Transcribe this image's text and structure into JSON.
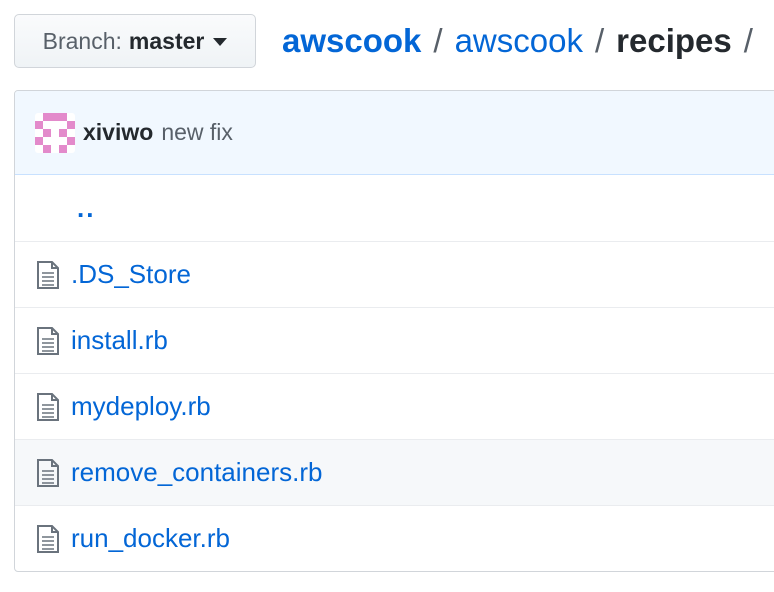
{
  "branch": {
    "prefix": "Branch:",
    "name": "master"
  },
  "breadcrumb": {
    "parts": [
      "awscook",
      "awscook",
      "recipes"
    ],
    "separator": "/"
  },
  "commit": {
    "author": "xiviwo",
    "message": "new fix"
  },
  "files": {
    "parent_link": "..",
    "items": [
      {
        "name": ".DS_Store",
        "icon": "file-icon"
      },
      {
        "name": "install.rb",
        "icon": "file-icon"
      },
      {
        "name": "mydeploy.rb",
        "icon": "file-icon"
      },
      {
        "name": "remove_containers.rb",
        "icon": "file-icon"
      },
      {
        "name": "run_docker.rb",
        "icon": "file-icon"
      }
    ]
  },
  "colors": {
    "link": "#0366d6",
    "commit_bar_bg": "#f1f8ff",
    "avatar": "#e38acb"
  }
}
